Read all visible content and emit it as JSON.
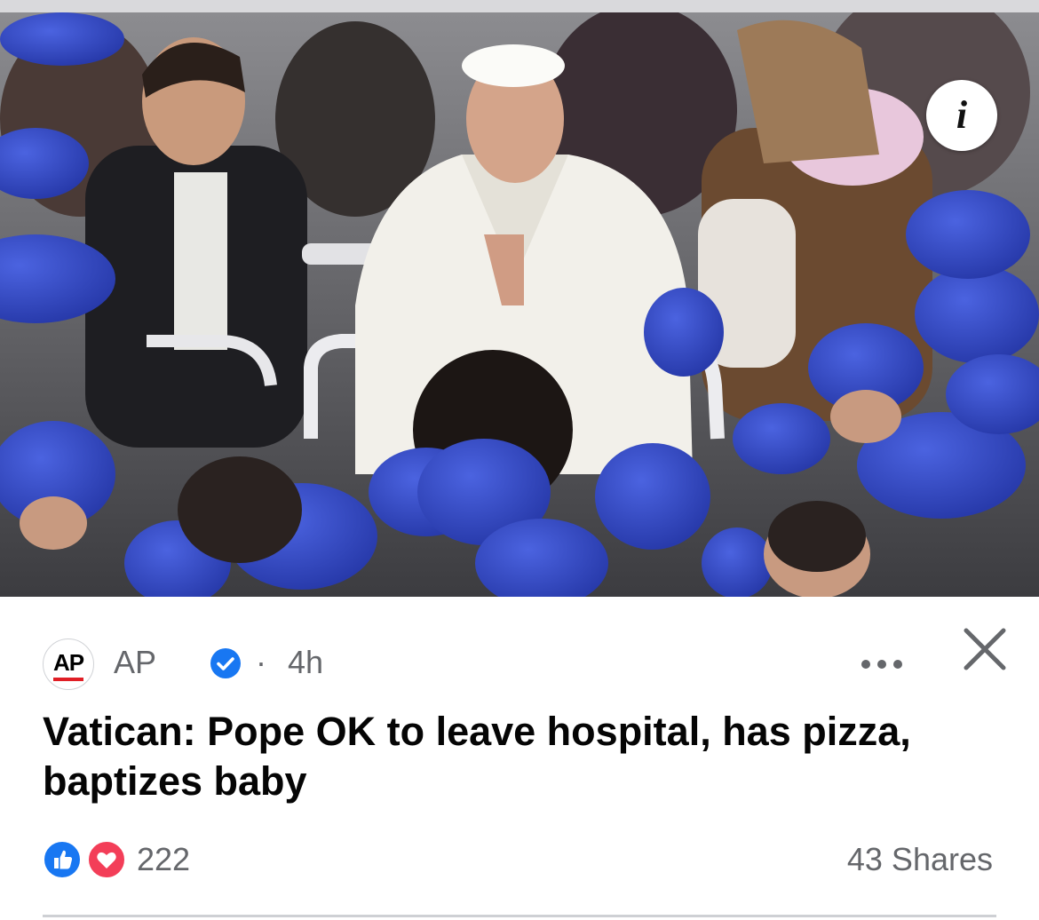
{
  "post": {
    "image_alt": "Pope Francis in white seated in a vehicle with hands pressed together, surrounded by children wearing blue caps",
    "info_label": "i",
    "source": {
      "avatar_text": "AP",
      "name": "AP",
      "verified": true,
      "separator": "·",
      "time": "4h"
    },
    "headline": "Vatican: Pope OK to leave hospital, has pizza, baptizes baby",
    "reactions": {
      "types": [
        "like",
        "love"
      ],
      "count": "222"
    },
    "shares": "43 Shares"
  },
  "colors": {
    "meta_text": "#65676b",
    "headline": "#050505",
    "verified_blue": "#1877f2",
    "love_red": "#f33e58",
    "ap_red": "#e01e25",
    "cap_blue": "#2f48c9",
    "divider": "#ced0d4"
  },
  "icons": {
    "info": "info-icon",
    "verified": "verified-badge-icon",
    "more": "more-options-icon",
    "close": "close-icon",
    "like": "thumbs-up-icon",
    "love": "heart-icon"
  }
}
